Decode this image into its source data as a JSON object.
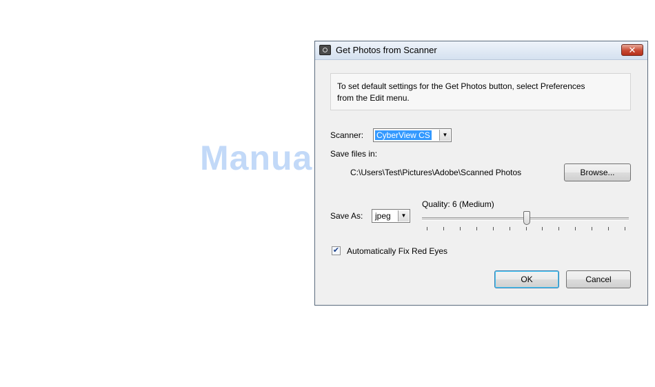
{
  "window": {
    "title": "Get Photos from Scanner",
    "close_glyph": "✕",
    "icon": "scanner-camera-icon"
  },
  "info": {
    "line1": "To set default settings for the Get Photos button, select Preferences",
    "line2": "from the Edit menu."
  },
  "scanner": {
    "label": "Scanner:",
    "value": "CyberView CS",
    "dropdown_glyph": "▼"
  },
  "save_files": {
    "label": "Save files in:",
    "path": "C:\\Users\\Test\\Pictures\\Adobe\\Scanned Photos",
    "browse_label": "Browse..."
  },
  "save_as": {
    "label": "Save As:",
    "value": "jpeg",
    "dropdown_glyph": "▼"
  },
  "quality": {
    "label": "Quality: 6 (Medium)",
    "value": 6,
    "min": 0,
    "max": 12
  },
  "red_eye": {
    "label": "Automatically Fix Red Eyes",
    "checked": true,
    "check_glyph": "✔"
  },
  "buttons": {
    "ok": "OK",
    "cancel": "Cancel"
  },
  "watermark": {
    "text": "ManualsLib.de"
  },
  "colors": {
    "dialog_bg": "#f0f0f0",
    "selection": "#3399ff",
    "close_button": "#c84a33"
  }
}
